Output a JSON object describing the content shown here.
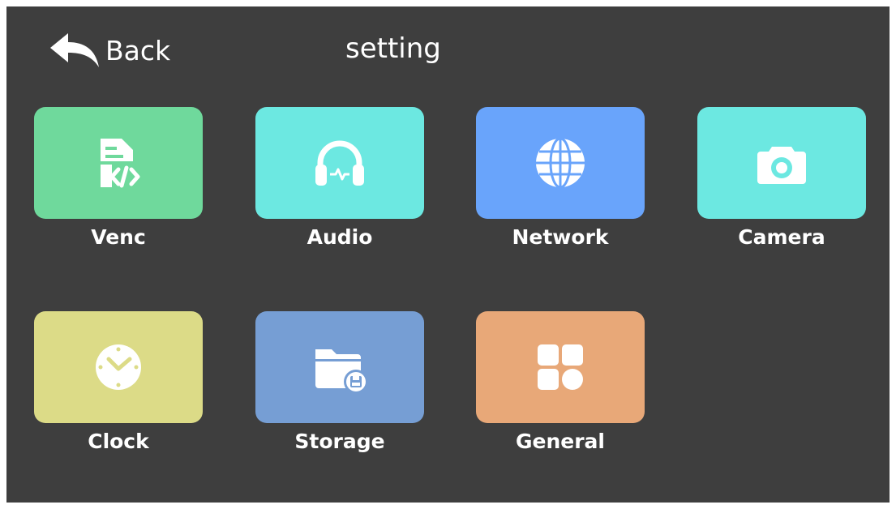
{
  "header": {
    "back_label": "Back",
    "title": "setting"
  },
  "tiles": [
    {
      "label": "Venc",
      "icon": "code-file-icon",
      "color": "#6fd99c"
    },
    {
      "label": "Audio",
      "icon": "headphones-icon",
      "color": "#6ce8e1"
    },
    {
      "label": "Network",
      "icon": "globe-icon",
      "color": "#69a4fb"
    },
    {
      "label": "Camera",
      "icon": "camera-icon",
      "color": "#6ce8e1"
    },
    {
      "label": "Clock",
      "icon": "clock-icon",
      "color": "#dcdb87"
    },
    {
      "label": "Storage",
      "icon": "folder-save-icon",
      "color": "#769ed4"
    },
    {
      "label": "General",
      "icon": "grid-shapes-icon",
      "color": "#e8a878"
    }
  ],
  "colors": {
    "screen_bg": "#3e3e3e",
    "text": "#ffffff"
  }
}
